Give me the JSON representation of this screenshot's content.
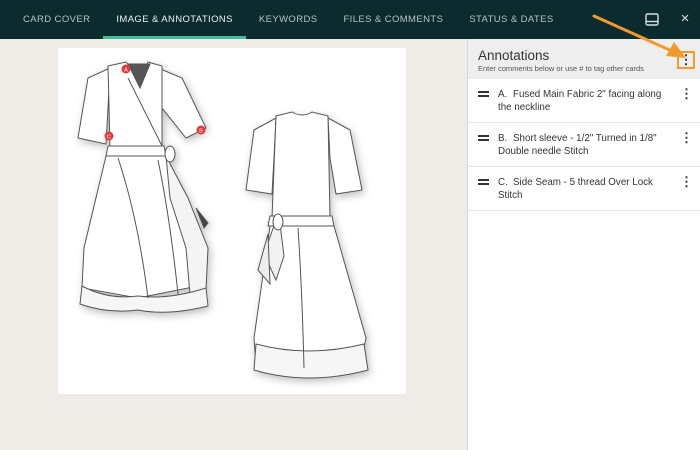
{
  "tabs": [
    {
      "label": "CARD COVER",
      "active": false
    },
    {
      "label": "IMAGE & ANNOTATIONS",
      "active": true
    },
    {
      "label": "KEYWORDS",
      "active": false
    },
    {
      "label": "FILES & COMMENTS",
      "active": false
    },
    {
      "label": "STATUS & DATES",
      "active": false
    }
  ],
  "window_icons": {
    "panel": "panel-layout-icon",
    "close": "×"
  },
  "canvas": {
    "markers": [
      {
        "letter": "A"
      },
      {
        "letter": "B"
      },
      {
        "letter": "C"
      }
    ],
    "marker_color": "#e03a3a"
  },
  "annotations_panel": {
    "title": "Annotations",
    "subtitle": "Enter comments below or use # to tag other cards",
    "menu_icon": "⋮",
    "items": [
      {
        "letter": "A.",
        "text": "Fused Main Fabric 2\" facing along the neckline"
      },
      {
        "letter": "B.",
        "text": "Short sleeve - 1/2\" Turned in 1/8\" Double needle Stitch"
      },
      {
        "letter": "C.",
        "text": "Side Seam - 5 thread Over Lock Stitch"
      }
    ]
  },
  "colors": {
    "topbar": "#0c2b2e",
    "active_tab_underline": "#3fbf9a",
    "highlight": "#f29a2e"
  }
}
